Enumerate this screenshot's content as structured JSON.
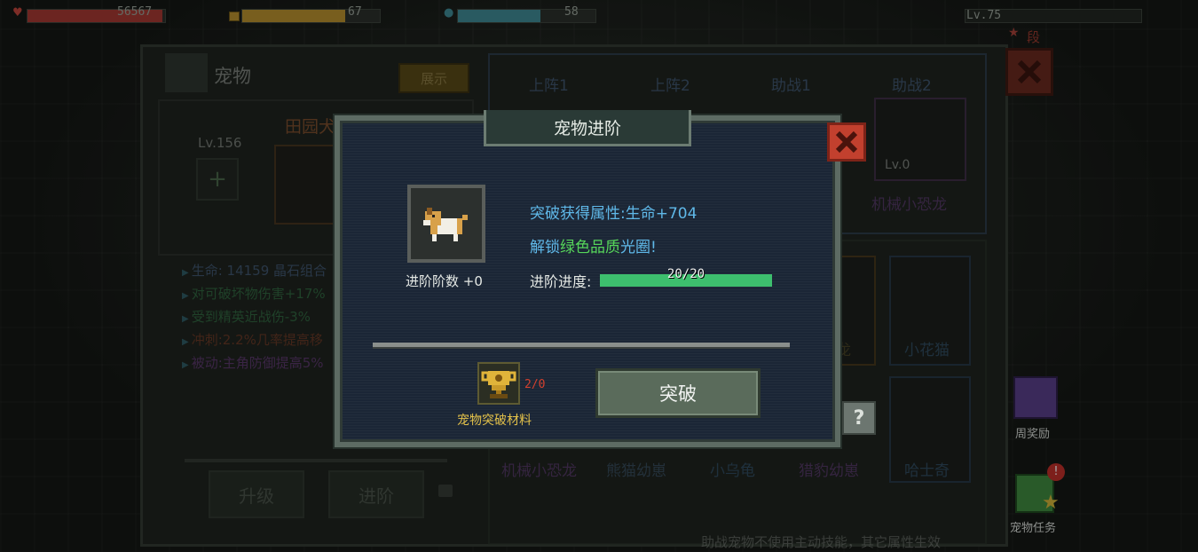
{
  "hud": {
    "health_value": "56567",
    "gold_value": "67",
    "energy_value": "58",
    "level": "Lv.75",
    "rank_text": "段位: E",
    "health_fill": 0.98,
    "gold_fill": 0.75,
    "energy_fill": 0.6,
    "colors": {
      "health": "#b8413a",
      "gold": "#b8912f",
      "energy": "#3f8a96"
    }
  },
  "pet_panel": {
    "title": "宠物",
    "show_button": "展示",
    "pet_name": "田园犬",
    "pet_level": "Lv.156",
    "add_symbol": "+",
    "stats": [
      {
        "text": "生命: 14159  晶石组合",
        "color": "#5a7fb0"
      },
      {
        "text": "对可破坏物伤害+17%",
        "color": "#3f9a5a"
      },
      {
        "text": "受到精英近战伤-3%",
        "color": "#3f9a5a"
      },
      {
        "text": "冲刺:2.2%几率提高移",
        "color": "#a04a2c"
      },
      {
        "text": "被动:主角防御提高5%",
        "color": "#8a4aa8"
      }
    ],
    "upgrade_button": "升级",
    "advance_button": "进阶",
    "tabs": [
      "上阵1",
      "上阵2",
      "助战1",
      "助战2"
    ],
    "assist2_pet_level": "Lv.0",
    "assist2_pet_name": "机械小恐龙",
    "grid_right_names": [
      "小花猫",
      "哈士奇"
    ],
    "grid_partial_name": "龙",
    "grid_bottom_names": [
      "机械小恐龙",
      "熊猫幼崽",
      "小乌龟",
      "猎豹幼崽",
      "哈士奇"
    ],
    "footer_note": "助战宠物不使用主动技能，其它属性生效"
  },
  "modal": {
    "title": "宠物进阶",
    "attr_gain": "突破获得属性:生命+704",
    "unlock_prefix": "解锁",
    "unlock_highlight": "绿色品质",
    "unlock_suffix": "光圈!",
    "stage_label": "进阶阶数 +0",
    "progress_label": "进阶进度:",
    "progress_text": "20/20",
    "progress_fraction": 1.0,
    "material_count": "2/0",
    "material_name": "宠物突破材料",
    "break_button": "突破",
    "help_symbol": "?"
  },
  "side": {
    "weekly_reward": "周奖励",
    "pet_task": "宠物任务",
    "badge": "!"
  }
}
